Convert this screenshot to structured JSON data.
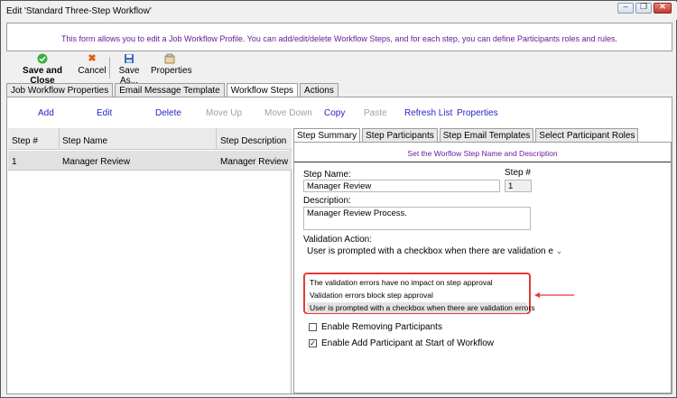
{
  "window": {
    "title": "Edit 'Standard Three-Step Workflow'",
    "controls": [
      "minimize-icon",
      "restore-icon",
      "close-icon"
    ]
  },
  "info": {
    "message": "This form allows you to edit a Job Workflow Profile. You can add/edit/delete Workflow Steps, and for each step, you can define Participants roles and rules."
  },
  "toolbar": {
    "save_close_label": "Save and Close",
    "cancel_label": "Cancel",
    "save_as_label": "Save As...",
    "properties_label": "Properties"
  },
  "tabs": [
    "Job Workflow Properties",
    "Email Message Template",
    "Workflow Steps",
    "Actions"
  ],
  "active_tab": "Workflow Steps",
  "actions": {
    "add": "Add",
    "edit": "Edit",
    "delete": "Delete",
    "move_up": "Move Up",
    "move_down": "Move Down",
    "copy": "Copy",
    "paste": "Paste",
    "refresh": "Refresh List",
    "properties": "Properties"
  },
  "grid": {
    "columns": [
      "Step #",
      "Step Name",
      "Step Description"
    ],
    "rows": [
      {
        "step": "1",
        "name": "Manager Review",
        "description": "Manager Review Proc"
      }
    ]
  },
  "step_tabs": [
    "Step Summary",
    "Step Participants",
    "Step Email Templates",
    "Select Participant Roles"
  ],
  "active_step_tab": "Step Summary",
  "summary": {
    "hint": "Set the Worflow Step Name and Description",
    "step_name_label": "Step Name:",
    "step_name_value": "Manager Review",
    "step_num_label": "Step #",
    "step_num_value": "1",
    "description_label": "Description:",
    "description_value": "Manager Review Process.",
    "validation_label": "Validation Action:",
    "validation_selected": "User is prompted with a checkbox when there are validation e",
    "validation_options": [
      "The validation errors have no impact on step approval",
      "Validation errors block step approval",
      "User is prompted with a checkbox when there are validation errors"
    ],
    "enable_removing_label": "Enable Removing Participants",
    "enable_removing_checked": false,
    "enable_add_label": "Enable Add Participant at Start of Workflow",
    "enable_add_checked": true
  },
  "colors": {
    "info_text": "#6a1b9a",
    "action_link": "#2525c8",
    "highlight": "#e53935"
  }
}
